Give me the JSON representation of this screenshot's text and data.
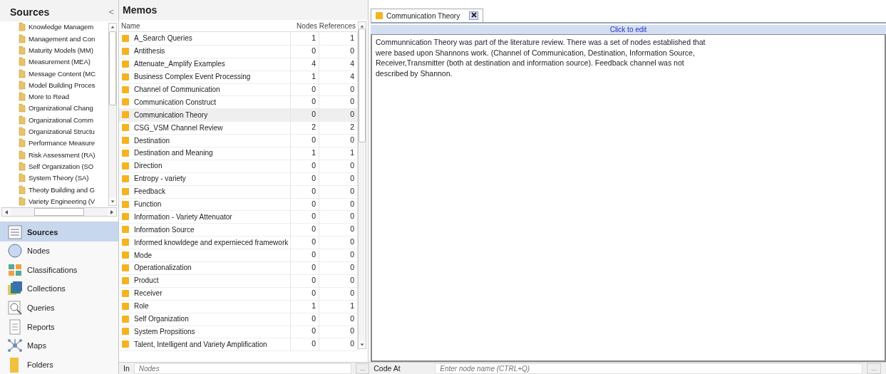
{
  "sources_panel": {
    "title": "Sources",
    "collapse": "<",
    "tree_items": [
      {
        "label": "Knowledge Managem"
      },
      {
        "label": "Management and Con"
      },
      {
        "label": "Maturity Models (MM)"
      },
      {
        "label": "Measurement (MEA)"
      },
      {
        "label": "Message Content (MC"
      },
      {
        "label": "Model Building Proces"
      },
      {
        "label": "More to Read"
      },
      {
        "label": "Organizational Chang"
      },
      {
        "label": "Organizational Comm"
      },
      {
        "label": "Organizational Structu"
      },
      {
        "label": "Performance Measure"
      },
      {
        "label": "Risk Assessment (RA)"
      },
      {
        "label": "Self Organization (SO"
      },
      {
        "label": "System Theory (SA)"
      },
      {
        "label": "Theoty Building and G"
      },
      {
        "label": "Variety Engineering (V"
      }
    ]
  },
  "navigation": [
    {
      "kind": "sources",
      "label": "Sources",
      "selected": true
    },
    {
      "kind": "nodes",
      "label": "Nodes",
      "selected": false
    },
    {
      "kind": "classifications",
      "label": "Classifications",
      "selected": false
    },
    {
      "kind": "collections",
      "label": "Collections",
      "selected": false
    },
    {
      "kind": "queries",
      "label": "Queries",
      "selected": false
    },
    {
      "kind": "reports",
      "label": "Reports",
      "selected": false
    },
    {
      "kind": "maps",
      "label": "Maps",
      "selected": false
    },
    {
      "kind": "folders",
      "label": "Folders",
      "selected": false
    }
  ],
  "memos": {
    "title": "Memos",
    "columns": [
      "Name",
      "Nodes",
      "References"
    ],
    "rows": [
      {
        "name": "A_Search Queries",
        "nodes": "1",
        "references": "1",
        "selected": false
      },
      {
        "name": "Antithesis",
        "nodes": "0",
        "references": "0",
        "selected": false
      },
      {
        "name": "Attenuate_Amplify Examples",
        "nodes": "4",
        "references": "4",
        "selected": false
      },
      {
        "name": "Business Complex Event Processing",
        "nodes": "1",
        "references": "4",
        "selected": false
      },
      {
        "name": "Channel of Communication",
        "nodes": "0",
        "references": "0",
        "selected": false
      },
      {
        "name": "Communication Construct",
        "nodes": "0",
        "references": "0",
        "selected": false
      },
      {
        "name": "Communication Theory",
        "nodes": "0",
        "references": "0",
        "selected": true
      },
      {
        "name": "CSG_VSM Channel Review",
        "nodes": "2",
        "references": "2",
        "selected": false
      },
      {
        "name": "Destination",
        "nodes": "0",
        "references": "0",
        "selected": false
      },
      {
        "name": "Destination and Meaning",
        "nodes": "1",
        "references": "1",
        "selected": false
      },
      {
        "name": "Direction",
        "nodes": "0",
        "references": "0",
        "selected": false
      },
      {
        "name": "Entropy - variety",
        "nodes": "0",
        "references": "0",
        "selected": false
      },
      {
        "name": "Feedback",
        "nodes": "0",
        "references": "0",
        "selected": false
      },
      {
        "name": "Function",
        "nodes": "0",
        "references": "0",
        "selected": false
      },
      {
        "name": "Information - Variety Attenuator",
        "nodes": "0",
        "references": "0",
        "selected": false
      },
      {
        "name": "Information Source",
        "nodes": "0",
        "references": "0",
        "selected": false
      },
      {
        "name": "Informed knowldege and expernieced framework",
        "nodes": "0",
        "references": "0",
        "selected": false
      },
      {
        "name": "Mode",
        "nodes": "0",
        "references": "0",
        "selected": false
      },
      {
        "name": "Operationalization",
        "nodes": "0",
        "references": "0",
        "selected": false
      },
      {
        "name": "Product",
        "nodes": "0",
        "references": "0",
        "selected": false
      },
      {
        "name": "Receiver",
        "nodes": "0",
        "references": "0",
        "selected": false
      },
      {
        "name": "Role",
        "nodes": "1",
        "references": "1",
        "selected": false
      },
      {
        "name": "Self Organization",
        "nodes": "0",
        "references": "0",
        "selected": false
      },
      {
        "name": "System Propsitions",
        "nodes": "0",
        "references": "0",
        "selected": false
      },
      {
        "name": "Talent, Intelligent and Variety Amplification",
        "nodes": "0",
        "references": "0",
        "selected": false
      }
    ]
  },
  "detail": {
    "tab": "Communication Theory",
    "edit_bar": "Click to edit",
    "text": "Communnication Theory was part of the literature review.  There was a set of nodes established that were based upon Shannons work. (Channel of Communication, Destination, Information Source, Receiver,Transmitter (both at destination and information source).  Feedback channel was not described by Shannon."
  },
  "bottom_bar": {
    "in_label": "In",
    "in_placeholder": "Nodes",
    "browse": "...",
    "code_at_label": "Code At",
    "code_at_placeholder": "Enter node name (CTRL+Q)",
    "browse_2": "..."
  }
}
